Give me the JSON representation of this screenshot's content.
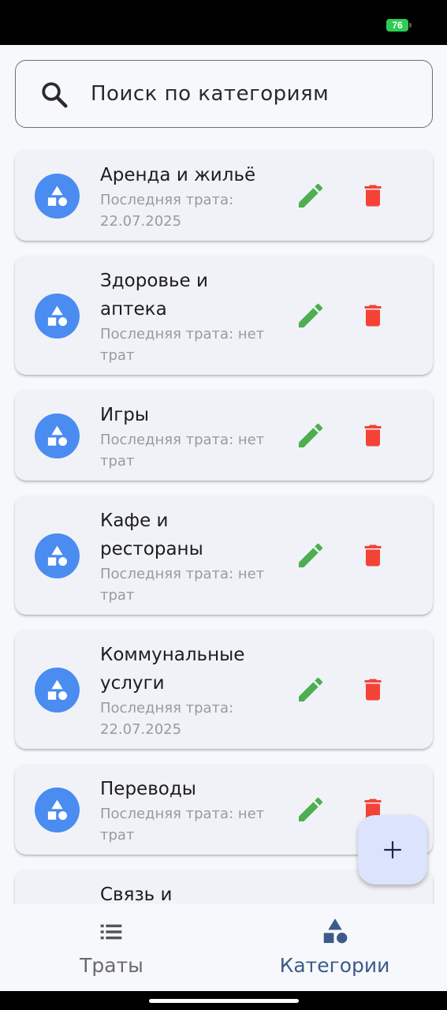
{
  "status_bar": {
    "battery": "76"
  },
  "search": {
    "placeholder": "Поиск по категориям"
  },
  "categories": [
    {
      "name": "Аренда и жильё",
      "last_spend": "Последняя трата: 22.07.2025"
    },
    {
      "name": "Здоровье и аптека",
      "last_spend": "Последняя трата: нет трат"
    },
    {
      "name": "Игры",
      "last_spend": "Последняя трата: нет трат"
    },
    {
      "name": "Кафе и рестораны",
      "last_spend": "Последняя трата: нет трат"
    },
    {
      "name": "Коммунальные услуги",
      "last_spend": "Последняя трата: 22.07.2025"
    },
    {
      "name": "Переводы",
      "last_spend": "Последняя трата: нет трат"
    },
    {
      "name": "Связь и",
      "last_spend": ""
    }
  ],
  "fab": {
    "icon": "plus-icon"
  },
  "bottom_nav": {
    "items": [
      {
        "label": "Траты",
        "icon": "list-icon",
        "active": false
      },
      {
        "label": "Категории",
        "icon": "category-icon",
        "active": true
      }
    ]
  },
  "colors": {
    "accent": "#4a8cf0",
    "edit": "#4caf50",
    "delete": "#f44336",
    "nav_active": "#3d5b88",
    "fab_bg": "#dbe3fd"
  }
}
